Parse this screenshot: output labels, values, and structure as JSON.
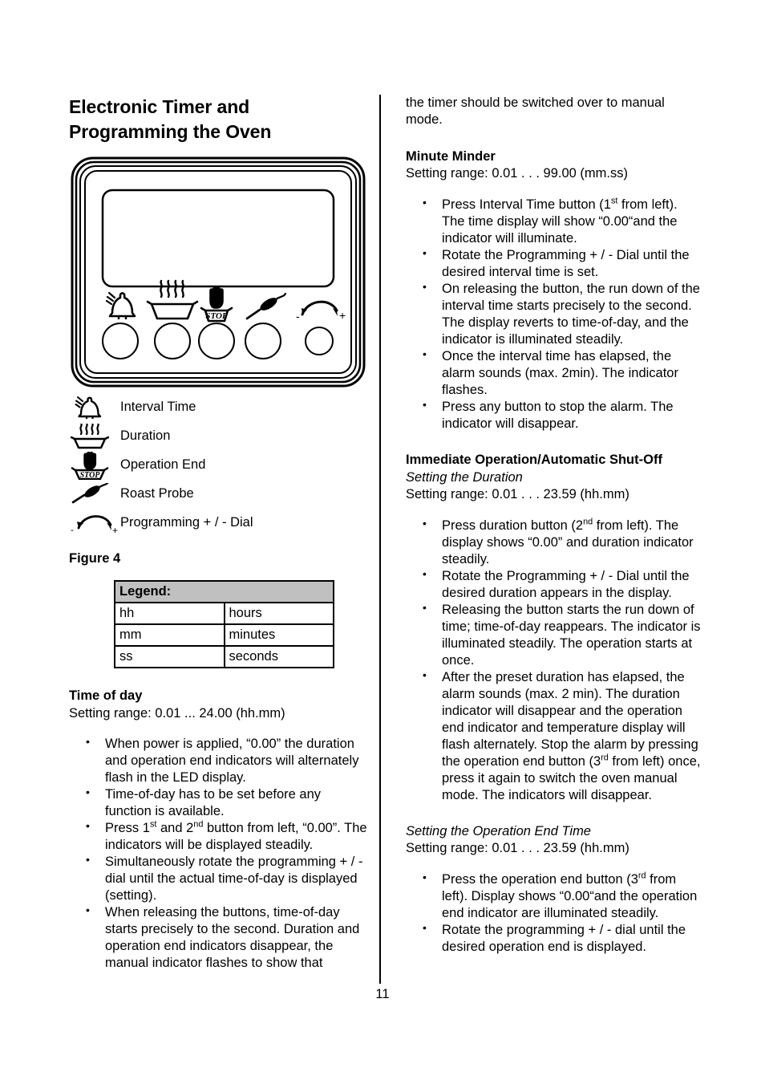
{
  "document": {
    "page_number": "11"
  },
  "left": {
    "title": "Electronic Timer and Programming the Oven",
    "figure_caption": "Figure 4",
    "panel": {
      "icons": [
        {
          "name": "bell-icon",
          "label": "Interval Time"
        },
        {
          "name": "steam-pan-icon",
          "label": "Duration"
        },
        {
          "name": "stop-hand-icon",
          "label": "Operation End",
          "text": "STOP"
        },
        {
          "name": "roast-probe-icon",
          "label": "Roast Probe"
        },
        {
          "name": "dial-arrow-icon",
          "label": "Programming + / - Dial",
          "minus": "-",
          "plus": "+"
        }
      ]
    },
    "legend_items": [
      {
        "icon": "bell-icon",
        "label": "Interval Time"
      },
      {
        "icon": "steam-pan-icon",
        "label": "Duration"
      },
      {
        "icon": "stop-hand-icon",
        "label": "Operation End"
      },
      {
        "icon": "roast-probe-icon",
        "label": "Roast Probe"
      },
      {
        "icon": "dial-arrow-icon",
        "label": "Programming + / - Dial"
      }
    ],
    "legend_table": {
      "header": "Legend:",
      "rows": [
        {
          "abbr": "hh",
          "meaning": "hours"
        },
        {
          "abbr": "mm",
          "meaning": "minutes"
        },
        {
          "abbr": "ss",
          "meaning": "seconds"
        }
      ]
    },
    "time_of_day": {
      "heading": "Time of day",
      "range": "Setting range: 0.01 ... 24.00 (hh.mm)",
      "bullets": [
        "When power is applied, “0.00” the duration and operation end indicators will alternately flash in the LED display.",
        "Time-of-day has to be set before any function is available.",
        "Simultaneously rotate the programming + / - dial until the actual time-of-day is displayed (setting).",
        "When releasing the buttons, time-of-day starts precisely to the second. Duration and operation end indicators disappear, the manual indicator flashes to show that"
      ],
      "bullet_press": {
        "pre": "Press 1",
        "sup1": "st",
        "mid": " and 2",
        "sup2": "nd",
        "post": " button from left, “0.00”. The indicators will be displayed steadily."
      }
    }
  },
  "right": {
    "continuation": "the timer should be switched over to manual mode.",
    "minute_minder": {
      "heading": "Minute Minder",
      "range": "Setting range: 0.01 . . . 99.00 (mm.ss)",
      "bullet_press": {
        "pre": "Press Interval Time button (1",
        "sup": "st",
        "post": " from left). The time display will show “0.00“and the indicator will illuminate."
      },
      "bullets": [
        "Rotate the Programming + / - Dial until the desired interval time is set.",
        "On releasing the button, the run down of the interval time starts precisely to the second. The display reverts to time-of-day, and the indicator is illuminated steadily.",
        "Once the interval time has elapsed, the alarm sounds (max. 2min). The indicator flashes.",
        "Press any button to stop the alarm. The indicator will disappear."
      ]
    },
    "immediate": {
      "heading": "Immediate Operation/Automatic Shut-Off",
      "subheading": "Setting the Duration",
      "range": "Setting range: 0.01 . . . 23.59 (hh.mm)",
      "bullet_press": {
        "pre": "Press duration button (2",
        "sup": "nd",
        "post": " from left). The display shows “0.00” and duration indicator steadily."
      },
      "bullets": [
        "Rotate the Programming + / - Dial until the desired duration appears in the display.",
        "Releasing the button starts the run down of time; time-of-day reappears. The indicator is illuminated steadily. The operation starts at once."
      ],
      "bullet_alarm": {
        "pre": "After the preset duration has elapsed, the alarm sounds (max. 2 min). The duration indicator will disappear and the operation end indicator and temperature display will flash alternately. Stop the alarm by pressing the operation end button (3",
        "sup": "rd",
        "post": " from left) once, press it again to switch the oven manual mode. The indicators will disappear."
      }
    },
    "operation_end": {
      "subheading": "Setting the Operation End Time",
      "range": "Setting range: 0.01 . . . 23.59 (hh.mm)",
      "bullet_press": {
        "pre": "Press the operation end button (3",
        "sup": "rd",
        "post": " from left). Display shows “0.00“and the operation end indicator are illuminated steadily."
      },
      "bullets": [
        "Rotate the programming + / - dial until the desired operation end is displayed."
      ]
    }
  }
}
